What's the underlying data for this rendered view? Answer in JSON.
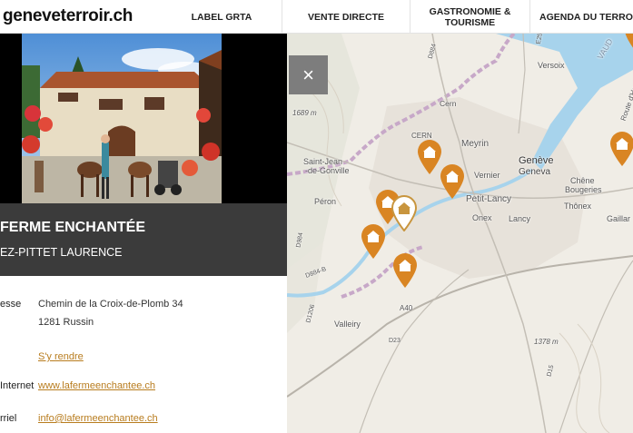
{
  "site": {
    "logo": "geneveterroir.ch"
  },
  "nav": [
    {
      "label": "LABEL GRTA"
    },
    {
      "label": "VENTE DIRECTE"
    },
    {
      "label": "GASTRONOMIE &\nTOURISME"
    },
    {
      "label": "AGENDA DU TERRO"
    }
  ],
  "listing": {
    "name": "LA FERME ENCHANTÉE",
    "name_visible": "FERME ENCHANTÉE",
    "owner_visible": "EZ-PITTET LAURENCE",
    "address_label": "esse",
    "address_line1": "Chemin de la Croix-de-Plomb 34",
    "address_line2": "1281 Russin",
    "directions_link": "S'y rendre",
    "internet_label": "Internet",
    "website": "www.lafermeenchantee.ch",
    "email_label": "rriel",
    "email": "info@lafermeenchantee.ch"
  },
  "map": {
    "close_label": "×",
    "labels": {
      "versoix": "Versoix",
      "cern": "Cern",
      "cern2": "CERN",
      "meyrin": "Meyrin",
      "geneve1": "Genève",
      "geneve2": "Geneva",
      "saint_jean": "Saint-Jean",
      "de_gonville": "-de-Gonville",
      "vernier": "Vernier",
      "chene": "Chêne",
      "bougeries": "Bougeries",
      "peron": "Péron",
      "petit_lancy": "Petit-Lancy",
      "thonex": "Thônex",
      "onex": "Onex",
      "lancy": "Lancy",
      "gaillard": "Gaillar",
      "valleiry": "Valleiry",
      "alt1": "1689 m",
      "alt2": "1378 m",
      "route_hermance": "Route d'Hermance",
      "vaud": "VAUD",
      "a40": "A40",
      "d884": "D884",
      "d984": "D984",
      "d35": "D35",
      "e25": "E25",
      "d1206": "D1206",
      "d23": "D23",
      "d884b": "D884-B",
      "d15": "D15"
    },
    "pin_color": "#d98523",
    "pin_selected_color": "#ffffff"
  }
}
